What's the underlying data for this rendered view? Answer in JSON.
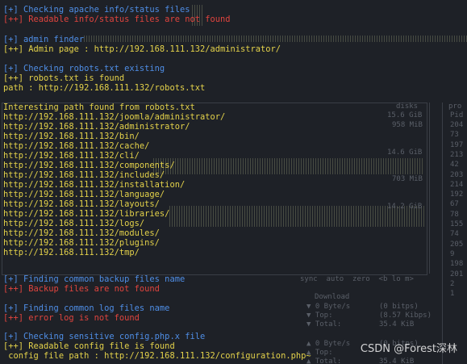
{
  "lines": [
    {
      "text": "[+] Checking apache info/status files",
      "color": "#4f8ee6"
    },
    {
      "text": "[++] Readable info/status files are not found",
      "color": "#e0443e"
    },
    {
      "text": "[+] admin finder",
      "color": "#4f8ee6"
    },
    {
      "text": "[++] Admin page : http://192.168.111.132/administrator/",
      "color": "#e4d24a"
    },
    {
      "text": "[+] Checking robots.txt existing",
      "color": "#4f8ee6"
    },
    {
      "text": "[++] robots.txt is found",
      "color": "#e4d24a"
    },
    {
      "text": "path : http://192.168.111.132/robots.txt",
      "color": "#e4d24a"
    },
    {
      "text": "Interesting path found from robots.txt",
      "color": "#e4d24a"
    },
    {
      "text": "http://192.168.111.132/joomla/administrator/",
      "color": "#e4d24a"
    },
    {
      "text": "http://192.168.111.132/administrator/",
      "color": "#e4d24a"
    },
    {
      "text": "http://192.168.111.132/bin/",
      "color": "#e4d24a"
    },
    {
      "text": "http://192.168.111.132/cache/",
      "color": "#e4d24a"
    },
    {
      "text": "http://192.168.111.132/cli/",
      "color": "#e4d24a"
    },
    {
      "text": "http://192.168.111.132/components/",
      "color": "#e4d24a"
    },
    {
      "text": "http://192.168.111.132/includes/",
      "color": "#e4d24a"
    },
    {
      "text": "http://192.168.111.132/installation/",
      "color": "#e4d24a"
    },
    {
      "text": "http://192.168.111.132/language/",
      "color": "#e4d24a"
    },
    {
      "text": "http://192.168.111.132/layouts/",
      "color": "#e4d24a"
    },
    {
      "text": "http://192.168.111.132/libraries/",
      "color": "#e4d24a"
    },
    {
      "text": "http://192.168.111.132/logs/",
      "color": "#e4d24a"
    },
    {
      "text": "http://192.168.111.132/modules/",
      "color": "#e4d24a"
    },
    {
      "text": "http://192.168.111.132/plugins/",
      "color": "#e4d24a"
    },
    {
      "text": "http://192.168.111.132/tmp/",
      "color": "#e4d24a"
    },
    {
      "text": "[+] Finding common backup files name",
      "color": "#4f8ee6"
    },
    {
      "text": "[++] Backup files are not found",
      "color": "#e0443e"
    },
    {
      "text": "[+] Finding common log files name",
      "color": "#4f8ee6"
    },
    {
      "text": "[++] error log is not found",
      "color": "#e0443e"
    },
    {
      "text": "[+] Checking sensitive config.php.x file",
      "color": "#4f8ee6"
    },
    {
      "text": "[++] Readable config file is found",
      "color": "#e4d24a"
    },
    {
      "text": " config file path : http://192.168.111.132/configuration.php~",
      "color": "#e4d24a"
    }
  ],
  "background_panel": {
    "disks_header": "disks",
    "disk_values": [
      "15.6 GiB",
      "958 MiB",
      "14.6 GiB",
      "703 MiB",
      "14.2 GiB"
    ],
    "proc_header": "pro",
    "proc_sub": "Pid",
    "proc_ids": [
      "204",
      "73",
      "197",
      "213",
      "42",
      "203",
      "214",
      "192",
      "67",
      "78",
      "155",
      "74",
      "205",
      "9",
      "198",
      "201",
      "2",
      "1"
    ],
    "sync_bar": "sync  auto  zero  <b lo m>",
    "download_label": "Download",
    "net_rows": [
      {
        "label": "▼ 0 Byte/s",
        "value": "(0 bitps)"
      },
      {
        "label": "▼ Top:",
        "value": "(8.57 Kibps)"
      },
      {
        "label": "▼ Total:",
        "value": "35.4 KiB"
      },
      {
        "label": "▲ 0 Byte/s",
        "value": "(0 bitps)"
      },
      {
        "label": "▲ Top:",
        "value": ""
      },
      {
        "label": "▲ Total:",
        "value": "35.4 KiB"
      }
    ]
  },
  "watermark": "CSDN @Forest深林"
}
